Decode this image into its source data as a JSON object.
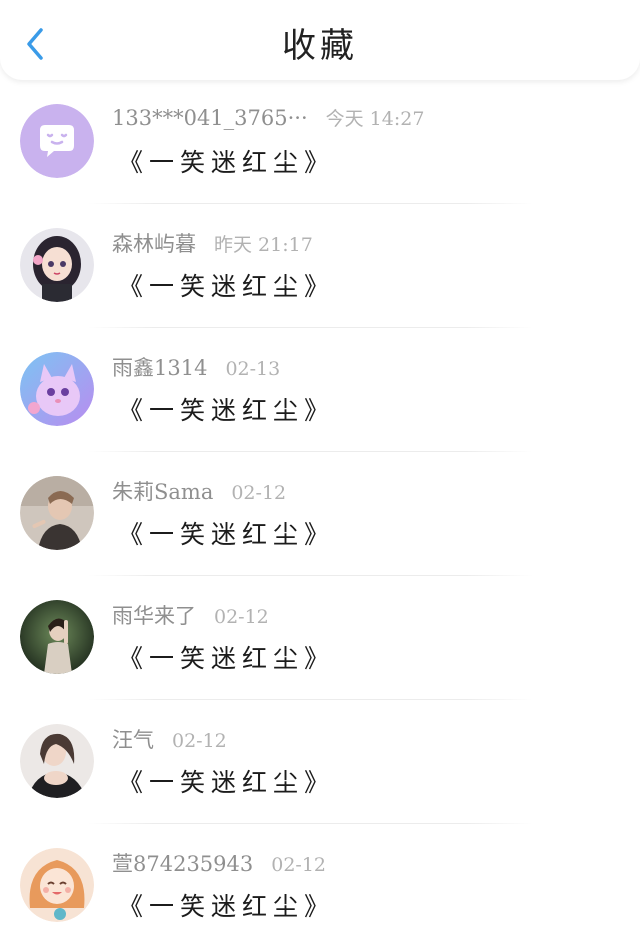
{
  "header": {
    "title": "收藏",
    "back_icon": "chevron-left-icon",
    "accent": "#3a9be8"
  },
  "favorites": [
    {
      "name": "133***041_3765···",
      "time": "今天 14:27",
      "message": "《一笑迷红尘》",
      "avatar": "chat-bubble-avatar"
    },
    {
      "name": "森林屿暮",
      "time": "昨天 21:17",
      "message": "《一笑迷红尘》",
      "avatar": "anime-girl-avatar"
    },
    {
      "name": "雨鑫1314",
      "time": "02-13",
      "message": "《一笑迷红尘》",
      "avatar": "purple-cat-avatar"
    },
    {
      "name": "朱莉Sama",
      "time": "02-12",
      "message": "《一笑迷红尘》",
      "avatar": "photo-avatar"
    },
    {
      "name": "雨华来了",
      "time": "02-12",
      "message": "《一笑迷红尘》",
      "avatar": "photo-avatar"
    },
    {
      "name": "汪气",
      "time": "02-12",
      "message": "《一笑迷红尘》",
      "avatar": "photo-avatar"
    },
    {
      "name": "萱874235943",
      "time": "02-12",
      "message": "《一笑迷红尘》",
      "avatar": "cartoon-girl-avatar"
    }
  ]
}
